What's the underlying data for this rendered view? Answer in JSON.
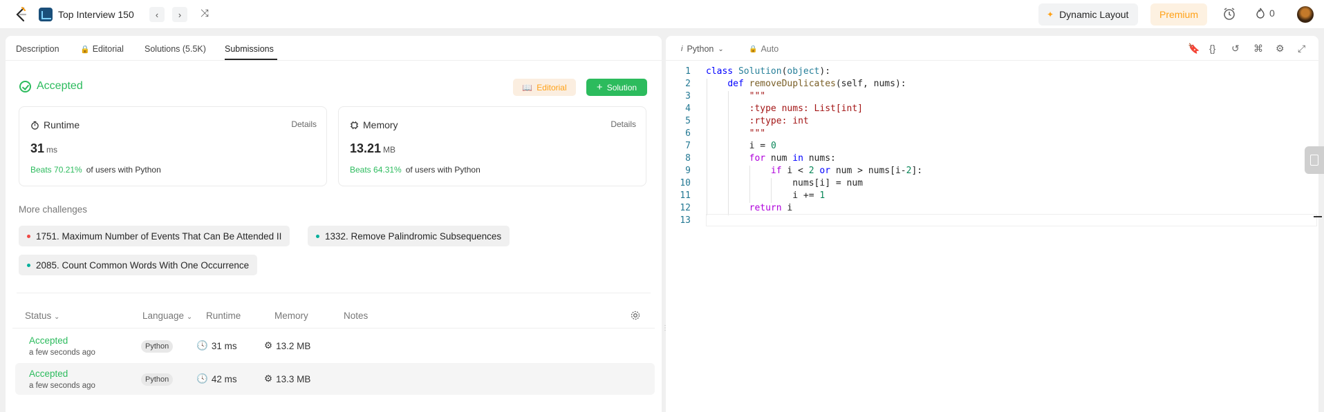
{
  "topbar": {
    "list_title": "Top Interview 150",
    "prev_icon": "‹",
    "next_icon": "›",
    "shuffle_icon": "⤨",
    "dynamic_layout": "Dynamic Layout",
    "premium": "Premium",
    "streak_count": "0"
  },
  "tabs": [
    {
      "label": "Description"
    },
    {
      "label": "Editorial"
    },
    {
      "label": "Solutions (5.5K)"
    },
    {
      "label": "Submissions"
    }
  ],
  "result": {
    "status": "Accepted",
    "editorial_btn": "Editorial",
    "solution_btn": "Solution"
  },
  "runtime_card": {
    "title": "Runtime",
    "details": "Details",
    "value": "31",
    "unit": "ms",
    "beats": "Beats 70.21%",
    "users": "of users with Python"
  },
  "memory_card": {
    "title": "Memory",
    "details": "Details",
    "value": "13.21",
    "unit": "MB",
    "beats": "Beats 64.31%",
    "users": "of users with Python"
  },
  "more_challenges": {
    "title": "More challenges",
    "items": [
      {
        "label": "1751. Maximum Number of Events That Can Be Attended II",
        "color": "#ef4743"
      },
      {
        "label": "1332. Remove Palindromic Subsequences",
        "color": "#00af9b"
      },
      {
        "label": "2085. Count Common Words With One Occurrence",
        "color": "#00af9b"
      }
    ]
  },
  "table": {
    "headers": {
      "status": "Status",
      "language": "Language",
      "runtime": "Runtime",
      "memory": "Memory",
      "notes": "Notes"
    },
    "rows": [
      {
        "status": "Accepted",
        "ago": "a few seconds ago",
        "language": "Python",
        "runtime": "31 ms",
        "memory": "13.2 MB"
      },
      {
        "status": "Accepted",
        "ago": "a few seconds ago",
        "language": "Python",
        "runtime": "42 ms",
        "memory": "13.3 MB"
      }
    ]
  },
  "editor": {
    "language": "Python",
    "mode": "Auto",
    "line_numbers": [
      "1",
      "2",
      "3",
      "4",
      "5",
      "6",
      "7",
      "8",
      "9",
      "10",
      "11",
      "12",
      "13"
    ]
  },
  "colors": {
    "accent_green": "#2cbb5d",
    "brand_orange": "#ffa116"
  }
}
